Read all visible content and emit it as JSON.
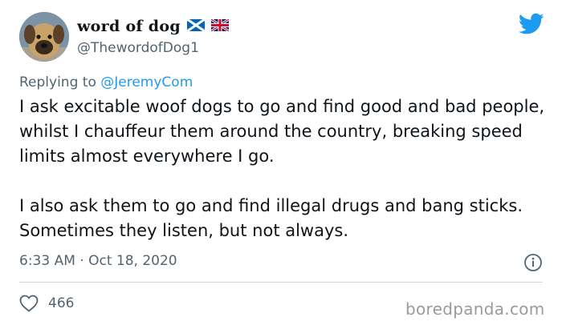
{
  "author": {
    "display_name": "word of dog",
    "handle": "@ThewordofDog1",
    "flags": [
      "scotland-flag",
      "uk-flag"
    ]
  },
  "reply": {
    "prefix": "Replying to",
    "mention": "@JeremyCom"
  },
  "tweet": {
    "paragraphs": [
      "I ask excitable woof dogs to go and find good and bad people, whilst I chauffeur them around the country, breaking speed limits almost everywhere I go.",
      "I also ask them to go and find illegal drugs and bang sticks. Sometimes they listen, but not always."
    ],
    "timestamp": "6:33 AM · Oct 18, 2020"
  },
  "engagement": {
    "likes": "466"
  },
  "watermark": "boredpanda.com",
  "colors": {
    "brand_blue": "#1d9bf0",
    "secondary_text": "#536471",
    "divider": "#cfd9de"
  },
  "icons": {
    "brand": "twitter-bird-icon",
    "info": "info-icon",
    "like": "heart-icon"
  }
}
